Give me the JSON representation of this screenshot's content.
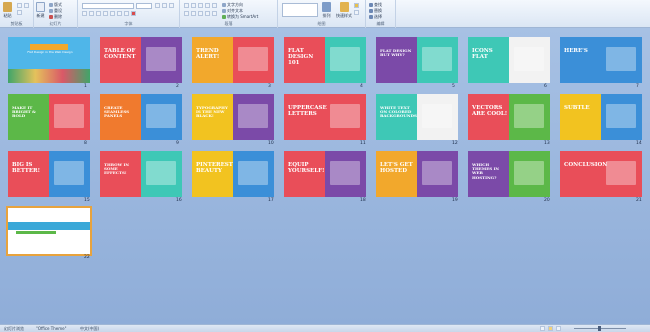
{
  "ribbon": {
    "groups": [
      {
        "label": "剪贴板"
      },
      {
        "label": "幻灯片"
      },
      {
        "label": "字体"
      },
      {
        "label": "段落"
      },
      {
        "label": "绘图"
      },
      {
        "label": "编辑"
      }
    ],
    "buttons": {
      "paste": "粘贴",
      "new_slide": "新建",
      "layout": "版式",
      "reset": "重设",
      "delete": "删除",
      "text_direction": "文字方向",
      "align_text": "对齐文本",
      "smartart": "转换为 SmartArt",
      "arrange": "排列",
      "quick_styles": "快速样式",
      "find": "查找",
      "replace": "替换",
      "select": "选择"
    }
  },
  "slides": [
    {
      "num": "1",
      "title": "Flat Design in the Web Design",
      "colors": [
        "#4fb6e9",
        "#4fb6e9"
      ],
      "kind": "cover"
    },
    {
      "num": "2",
      "title": "TABLE OF CONTENT",
      "colors": [
        "#e94e59",
        "#7b4aa8"
      ],
      "kind": "split"
    },
    {
      "num": "3",
      "title": "TREND ALERT!",
      "colors": [
        "#f2a82c",
        "#e94e59"
      ],
      "kind": "split"
    },
    {
      "num": "4",
      "title": "FLAT DESIGN 101",
      "colors": [
        "#e94e59",
        "#3ec8b6"
      ],
      "kind": "split"
    },
    {
      "num": "5",
      "title": "Flat Design BUT WHY?",
      "colors": [
        "#7b4aa8",
        "#3ec8b6"
      ],
      "kind": "split"
    },
    {
      "num": "6",
      "title": "ICONS FLAT",
      "colors": [
        "#3ec8b6",
        "#f2f2f2"
      ],
      "kind": "split"
    },
    {
      "num": "7",
      "title": "HERE'S",
      "colors": [
        "#3b8fd8",
        "#3b8fd8"
      ],
      "kind": "split"
    },
    {
      "num": "8",
      "title": "MAKE IT BRIGHT & BOLD",
      "colors": [
        "#5cb848",
        "#e94e59"
      ],
      "kind": "split"
    },
    {
      "num": "9",
      "title": "CREATE SEAMLESS PANELS",
      "colors": [
        "#f07a2e",
        "#3b8fd8"
      ],
      "kind": "split"
    },
    {
      "num": "10",
      "title": "Typography IS THE NEW BLACK!",
      "colors": [
        "#f2c320",
        "#7b4aa8"
      ],
      "kind": "split"
    },
    {
      "num": "11",
      "title": "UPPERCASE LETTERS",
      "colors": [
        "#e94e59",
        "#e94e59"
      ],
      "kind": "split"
    },
    {
      "num": "12",
      "title": "WHITE TEXT ON COLORED BACKGROUNDS",
      "colors": [
        "#3ec8b6",
        "#f2f2f2"
      ],
      "kind": "split"
    },
    {
      "num": "13",
      "title": "VECTORS ARE COOL!",
      "colors": [
        "#e94e59",
        "#5cb848"
      ],
      "kind": "split"
    },
    {
      "num": "14",
      "title": "SUBTLE",
      "colors": [
        "#f2c320",
        "#3b8fd8"
      ],
      "kind": "split"
    },
    {
      "num": "15",
      "title": "BIG IS BETTER!",
      "colors": [
        "#e94e59",
        "#3b8fd8"
      ],
      "kind": "split"
    },
    {
      "num": "16",
      "title": "THROW IN SOME EFFECTS!",
      "colors": [
        "#e94e59",
        "#3ec8b6"
      ],
      "kind": "split"
    },
    {
      "num": "17",
      "title": "PINTEREST BEAUTY",
      "colors": [
        "#f2c320",
        "#3b8fd8"
      ],
      "kind": "split"
    },
    {
      "num": "18",
      "title": "EQUIP YOURSELF!",
      "colors": [
        "#e94e59",
        "#7b4aa8"
      ],
      "kind": "split"
    },
    {
      "num": "19",
      "title": "Let's GET HOSTED",
      "colors": [
        "#f2a82c",
        "#7b4aa8"
      ],
      "kind": "split"
    },
    {
      "num": "20",
      "title": "WHICH Themes IN WEB HOSTING?",
      "colors": [
        "#7b4aa8",
        "#5cb848"
      ],
      "kind": "split"
    },
    {
      "num": "21",
      "title": "CONCLUSION",
      "colors": [
        "#e94e59",
        "#e94e59"
      ],
      "kind": "split"
    },
    {
      "num": "22",
      "title": "",
      "colors": [
        "#ffffff",
        "#ffffff"
      ],
      "kind": "blank"
    }
  ],
  "status": {
    "view": "幻灯片浏览",
    "theme": "\"Office Theme\"",
    "language": "中文(中国)"
  }
}
